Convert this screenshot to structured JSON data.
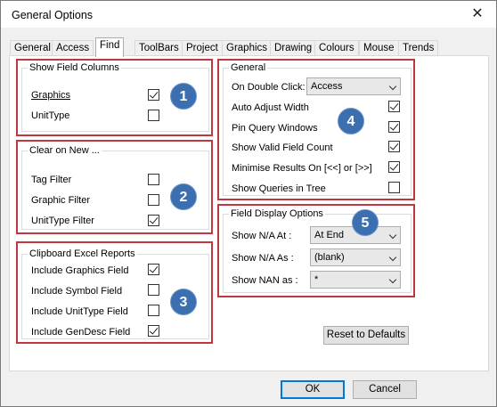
{
  "window": {
    "title": "General Options",
    "close_glyph": "✕"
  },
  "tabs": [
    "General",
    "Access",
    "Find",
    "ToolBars",
    "Project",
    "Graphics",
    "Drawing",
    "Colours",
    "Mouse",
    "Trends"
  ],
  "active_tab": "Find",
  "show_field_columns": {
    "legend": "Show Field Columns",
    "items": [
      {
        "label": "Graphics",
        "checked": true
      },
      {
        "label": "UnitType",
        "checked": false
      }
    ]
  },
  "clear_on_new": {
    "legend": "Clear on New ...",
    "items": [
      {
        "label": "Tag Filter",
        "checked": false
      },
      {
        "label": "Graphic Filter",
        "checked": false
      },
      {
        "label": "UnitType Filter",
        "checked": true
      }
    ]
  },
  "clipboard_excel": {
    "legend": "Clipboard Excel Reports",
    "items": [
      {
        "label": "Include Graphics Field",
        "checked": true
      },
      {
        "label": "Include Symbol Field",
        "checked": false
      },
      {
        "label": "Include UnitType Field",
        "checked": false
      },
      {
        "label": "Include GenDesc Field",
        "checked": true
      }
    ]
  },
  "general": {
    "legend": "General",
    "double_click_label": "On Double Click:",
    "double_click_value": "Access",
    "items": [
      {
        "label": "Auto Adjust Width",
        "checked": true
      },
      {
        "label": "Pin Query Windows",
        "checked": true
      },
      {
        "label": "Show Valid Field Count",
        "checked": true
      },
      {
        "label": "Minimise Results On  [<<] or  [>>]",
        "checked": true
      },
      {
        "label": "Show Queries in Tree",
        "checked": false
      }
    ]
  },
  "field_display": {
    "legend": "Field Display Options",
    "rows": [
      {
        "label": "Show N/A At :",
        "value": "At End"
      },
      {
        "label": "Show N/A As :",
        "value": "(blank)"
      },
      {
        "label": "Show NAN as :",
        "value": "*"
      }
    ]
  },
  "buttons": {
    "reset": "Reset to Defaults",
    "ok": "OK",
    "cancel": "Cancel"
  },
  "badges": [
    "1",
    "2",
    "3",
    "4",
    "5"
  ],
  "colors": {
    "highlight_box": "#c0373f",
    "badge": "#3b6fb0",
    "default_button": "#0078d7"
  }
}
